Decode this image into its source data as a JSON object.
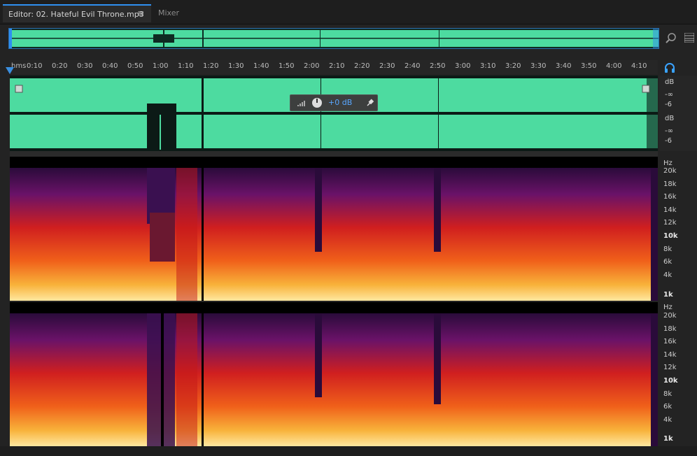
{
  "tabs": {
    "editor": "Editor: 02. Hateful Evil Throne.mp3",
    "menu": "≡",
    "mixer": "Mixer"
  },
  "ruler": {
    "labels": [
      "hms",
      "0:10",
      "0:20",
      "0:30",
      "0:40",
      "0:50",
      "1:00",
      "1:10",
      "1:20",
      "1:30",
      "1:40",
      "1:50",
      "2:00",
      "2:10",
      "2:20",
      "2:30",
      "2:40",
      "2:50",
      "3:00",
      "3:10",
      "3:20",
      "3:30",
      "3:40",
      "3:50",
      "4:00",
      "4:10"
    ]
  },
  "hud": {
    "gain": "+0 dB"
  },
  "db_scale": {
    "unit": "dB",
    "ch1": [
      "dB",
      "-∞",
      "-6"
    ],
    "ch2": [
      "dB",
      "-∞",
      "-6"
    ]
  },
  "hz_scale": [
    "Hz",
    "20k",
    "18k",
    "16k",
    "14k",
    "12k",
    "10k",
    "8k",
    "6k",
    "4k",
    "1k"
  ],
  "colors": {
    "waveform": "#4ddba0",
    "accent": "#2f8ff0",
    "background": "#232323"
  },
  "icons": {
    "zoom": "zoom-icon",
    "panel": "panel-icon",
    "headphones": "headphone-icon",
    "pin": "pin-icon",
    "knob": "volume-knob-icon"
  }
}
